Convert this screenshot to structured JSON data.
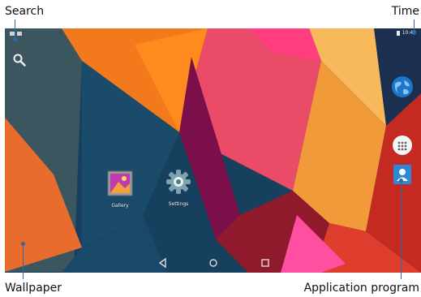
{
  "callouts": {
    "search": "Search",
    "time": "Time",
    "wallpaper": "Wallpaper",
    "application_program": "Application program"
  },
  "status_bar": {
    "time": "10:42"
  },
  "home_apps": [
    {
      "label": "Gallery",
      "icon": "gallery-icon"
    },
    {
      "label": "Settings",
      "icon": "settings-icon"
    }
  ],
  "dock": [
    {
      "icon": "browser-globe-icon"
    },
    {
      "icon": "app-drawer-icon"
    },
    {
      "icon": "contacts-icon"
    }
  ],
  "navigation_bar": [
    {
      "icon": "back-icon"
    },
    {
      "icon": "home-icon"
    },
    {
      "icon": "recents-icon"
    }
  ],
  "colors": {
    "leader_line": "#2d6aa8",
    "wallpaper_base": "#17405f"
  }
}
